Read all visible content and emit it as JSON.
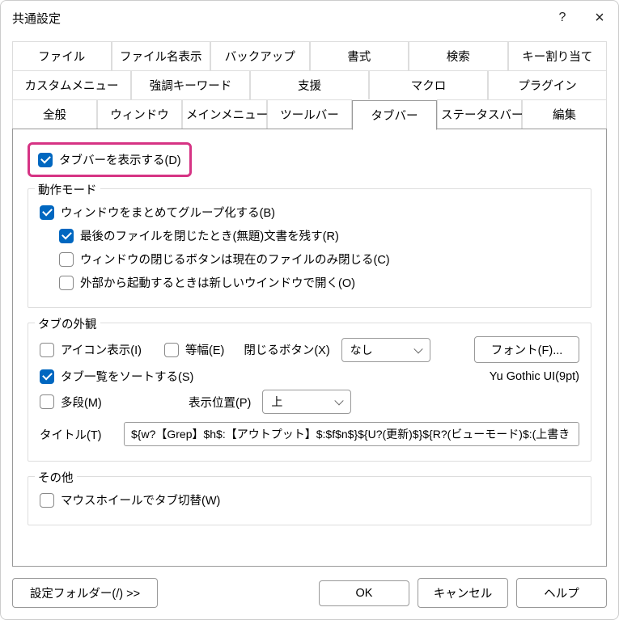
{
  "titlebar": {
    "title": "共通設定",
    "help": "?",
    "close": "×"
  },
  "tabs": {
    "row1": [
      "ファイル",
      "ファイル名表示",
      "バックアップ",
      "書式",
      "検索",
      "キー割り当て"
    ],
    "row2": [
      "カスタムメニュー",
      "強調キーワード",
      "支援",
      "マクロ",
      "プラグイン"
    ],
    "row3": [
      "全般",
      "ウィンドウ",
      "メインメニュー",
      "ツールバー",
      "タブバー",
      "ステータスバー",
      "編集"
    ],
    "active": "タブバー"
  },
  "main": {
    "show_tabbar": "タブバーを表示する(D)"
  },
  "behavior": {
    "title": "動作モード",
    "group_windows": "ウィンドウをまとめてグループ化する(B)",
    "keep_untitled": "最後のファイルを閉じたとき(無題)文書を残す(R)",
    "close_current_only": "ウィンドウの閉じるボタンは現在のファイルのみ閉じる(C)",
    "open_new_window": "外部から起動するときは新しいウインドウで開く(O)"
  },
  "appearance": {
    "title": "タブの外観",
    "show_icon": "アイコン表示(I)",
    "equal_width": "等幅(E)",
    "close_button_label": "閉じるボタン(X)",
    "close_button_value": "なし",
    "font_button": "フォント(F)...",
    "sort_tabs": "タブ一覧をソートする(S)",
    "font_display": "Yu Gothic UI(9pt)",
    "multirow": "多段(M)",
    "position_label": "表示位置(P)",
    "position_value": "上",
    "title_label": "タイトル(T)",
    "title_value": "${w?【Grep】$h$:【アウトプット】$:$f$n$}${U?(更新)$}${R?(ビューモード)$:(上書き"
  },
  "other": {
    "title": "その他",
    "wheel_switch": "マウスホイールでタブ切替(W)"
  },
  "footer": {
    "settings_folder": "設定フォルダー(/) >>",
    "ok": "OK",
    "cancel": "キャンセル",
    "help": "ヘルプ"
  }
}
